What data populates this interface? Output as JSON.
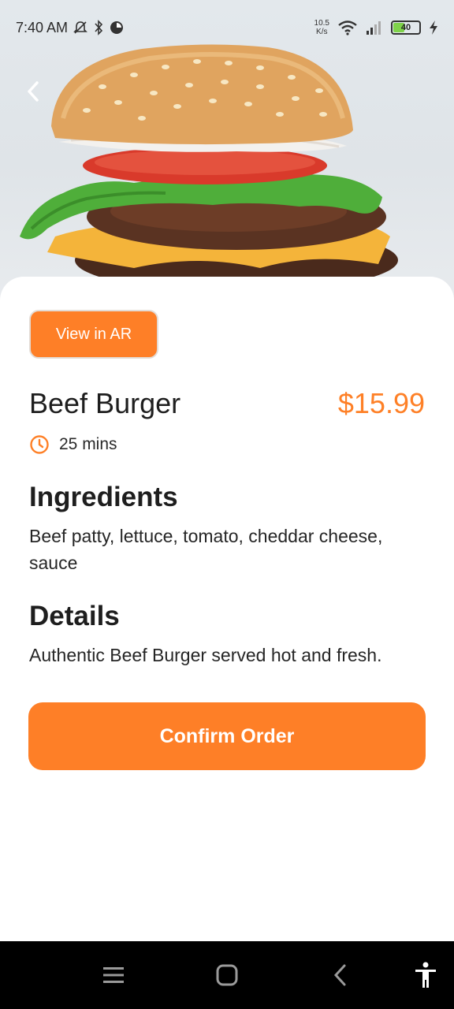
{
  "status_bar": {
    "time": "7:40 AM",
    "net_speed_value": "10.5",
    "net_speed_unit": "K/s",
    "battery_level": "40",
    "icons": [
      "mute-icon",
      "bluetooth-icon",
      "data-saver-icon",
      "wifi-icon",
      "signal-icon",
      "battery-icon",
      "charging-icon"
    ]
  },
  "colors": {
    "accent": "#fe7f27",
    "price": "#fe8027",
    "nav_bar": "#000000"
  },
  "product": {
    "ar_button_label": "View in AR",
    "name": "Beef Burger",
    "price": "$15.99",
    "prep_time": "25 mins",
    "ingredients_heading": "Ingredients",
    "ingredients_text": "Beef patty, lettuce, tomato, cheddar cheese, sauce",
    "details_heading": "Details",
    "details_text": "Authentic Beef Burger served hot and fresh.",
    "confirm_label": "Confirm Order"
  },
  "nav": {
    "icons": [
      "menu-icon",
      "home-icon",
      "back-icon",
      "accessibility-icon"
    ]
  }
}
